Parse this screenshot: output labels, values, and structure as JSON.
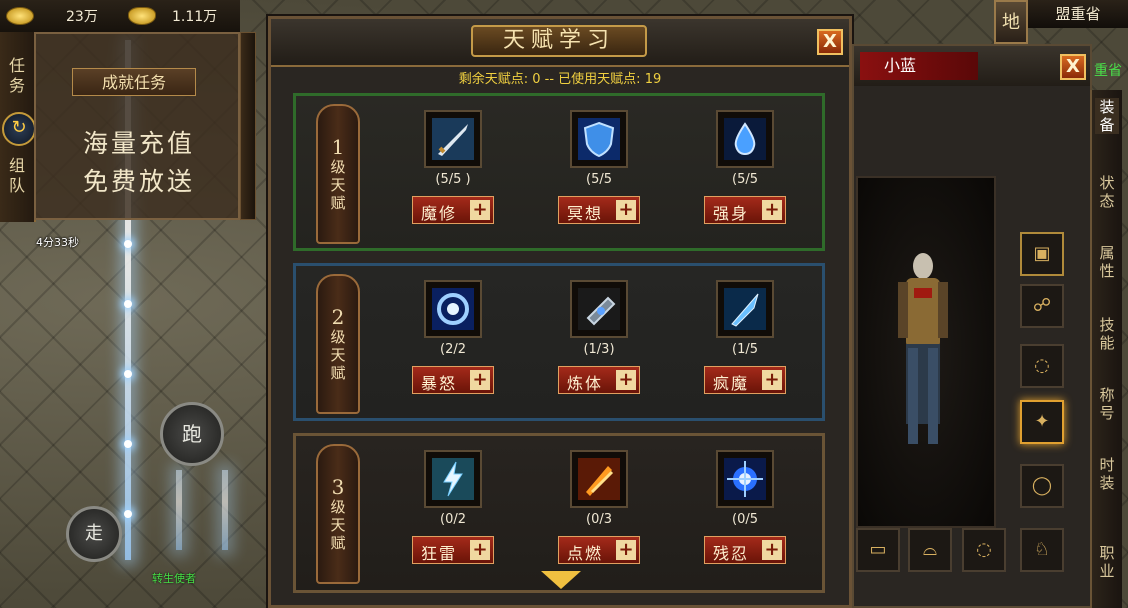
{
  "top_bar": {
    "gold_amount": "23万",
    "ingot_amount": "1.11万"
  },
  "left_tabs": {
    "task_label": "任务",
    "team_label": "组队"
  },
  "achievement": {
    "button_label": "成就任务",
    "line1": "海量充值",
    "line2": "免费放送"
  },
  "timer": "4分33秒",
  "controls": {
    "run_label": "跑",
    "walk_label": "走"
  },
  "npc_name": "转生使者",
  "talent_window": {
    "title": "天赋学习",
    "points_text": "剩余天赋点: 0 -- 已使用天赋点: 19",
    "close_label": "X",
    "tiers": [
      {
        "label_chars": [
          "1",
          "级",
          "天",
          "赋"
        ],
        "accent": "#2f6b2a",
        "skills": [
          {
            "name": "魔修",
            "count": "(5/5 )",
            "icon": "sword-icon"
          },
          {
            "name": "冥想",
            "count": "(5/5",
            "icon": "shield-icon"
          },
          {
            "name": "强身",
            "count": "(5/5",
            "icon": "water-drop-icon"
          }
        ]
      },
      {
        "label_chars": [
          "2",
          "级",
          "天",
          "赋"
        ],
        "accent": "#2a4f6e",
        "skills": [
          {
            "name": "暴怒",
            "count": "(2/2",
            "icon": "wind-swirl-icon"
          },
          {
            "name": "炼体",
            "count": "(1/3)",
            "icon": "arm-guard-icon"
          },
          {
            "name": "疯魔",
            "count": "(1/5",
            "icon": "blade-icon"
          }
        ]
      },
      {
        "label_chars": [
          "3",
          "级",
          "天",
          "赋"
        ],
        "accent": "#6a5436",
        "skills": [
          {
            "name": "狂雷",
            "count": "(0/2",
            "icon": "thunder-icon"
          },
          {
            "name": "点燃",
            "count": "(0/3",
            "icon": "flame-icon"
          },
          {
            "name": "残忍",
            "count": "(0/5",
            "icon": "energy-burst-icon"
          }
        ]
      }
    ]
  },
  "character_window": {
    "name": "小蓝",
    "close_label": "X",
    "side_tabs": [
      "装备",
      "状态",
      "属性",
      "技能",
      "称号",
      "时装",
      "职业"
    ]
  },
  "map_button_label": "地",
  "location_name": "盟重省",
  "zone_name": "重省",
  "colors": {
    "tier1_border": "#2f6b2a",
    "tier2_border": "#2a4f6e",
    "tier3_border": "#6a5436",
    "button_red": "#a42a1a",
    "points_yellow": "#f0d040"
  }
}
